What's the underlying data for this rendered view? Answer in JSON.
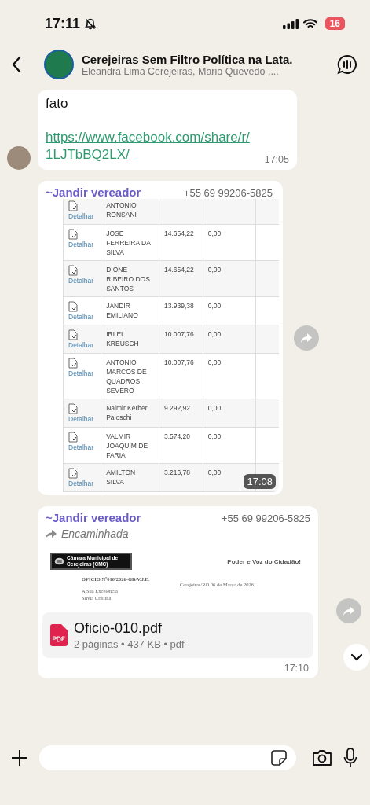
{
  "status_bar": {
    "time": "17:11",
    "battery": "16"
  },
  "header": {
    "title": "Cerejeiras Sem Filtro Política na Lata.",
    "subtitle": "Eleandra Lima Cerejeiras, Mario Quevedo ,..."
  },
  "messages": [
    {
      "kind": "text",
      "text": "fato",
      "link": "https://www.facebook.com/share/r/1LJTbBQ2LX/",
      "time": "17:05"
    },
    {
      "kind": "image",
      "sender": "~Jandir vereador",
      "phone": "+55 69 99206-5825",
      "time": "17:08",
      "table": {
        "rows": [
          {
            "action": "Detalhar",
            "name": "ANTONIO RONSANI",
            "column_3": "",
            "column_4": ""
          },
          {
            "action": "Detalhar",
            "name": "JOSE FERREIRA DA SILVA",
            "column_3": "14.654,22",
            "column_4": "0,00"
          },
          {
            "action": "Detalhar",
            "name": "DIONE RIBEIRO DOS SANTOS",
            "column_3": "14.654,22",
            "column_4": "0,00"
          },
          {
            "action": "Detalhar",
            "name": "JANDIR EMILIANO",
            "column_3": "13.939,38",
            "column_4": "0,00"
          },
          {
            "action": "Detalhar",
            "name": "IRLEI KREUSCH",
            "column_3": "10.007,76",
            "column_4": "0,00"
          },
          {
            "action": "Detalhar",
            "name": "ANTONIO MARCOS DE QUADROS SEVERO",
            "column_3": "10.007,76",
            "column_4": "0,00"
          },
          {
            "action": "Detalhar",
            "name": "Nalmir Kerber Paloschi",
            "column_3": "9.292,92",
            "column_4": "0,00"
          },
          {
            "action": "Detalhar",
            "name": "VALMIR JOAQUIM DE FARIA",
            "column_3": "3.574,20",
            "column_4": "0,00"
          },
          {
            "action": "Detalhar",
            "name": "AMILTON SILVA",
            "column_3": "3.216,78",
            "column_4": "0,00"
          }
        ]
      }
    },
    {
      "kind": "document",
      "sender": "~Jandir vereador",
      "phone": "+55 69 99206-5825",
      "forwarded_label": "Encaminhada",
      "preview": {
        "logo_text": "Câmara Municipal de Cerejeiras (CMC)",
        "tagline": "Poder e Voz do Cidadão!",
        "reference": "OFÍCIO Nº010/2026-GB/V.J.E.",
        "date": "Cerejeiras/RO 06 de Março de 2026.",
        "lines": [
          "A Sua Excelência",
          "Silvia Cristina"
        ]
      },
      "file_name": "Oficio-010.pdf",
      "file_info": "2 páginas • 437 KB • pdf",
      "time": "17:10"
    }
  ]
}
